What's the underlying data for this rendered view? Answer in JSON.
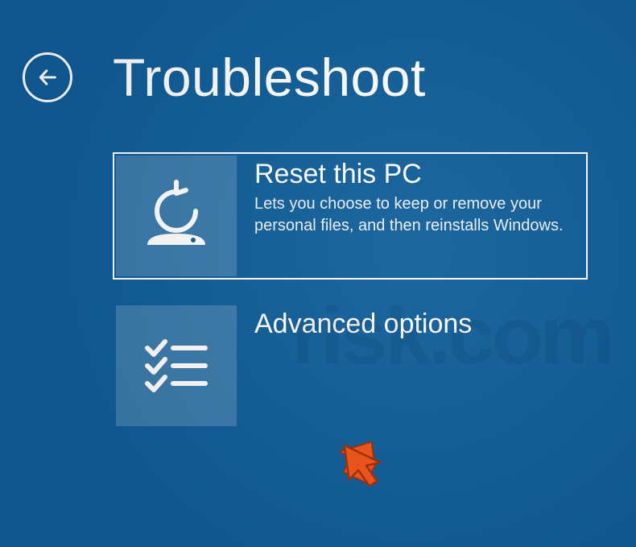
{
  "header": {
    "title": "Troubleshoot"
  },
  "options": [
    {
      "icon": "reset-pc-icon",
      "title": "Reset this PC",
      "description": "Lets you choose to keep or remove your personal files, and then reinstalls Windows.",
      "selected": true
    },
    {
      "icon": "advanced-options-icon",
      "title": "Advanced options",
      "description": "",
      "selected": false
    }
  ],
  "watermark": "risk.com"
}
